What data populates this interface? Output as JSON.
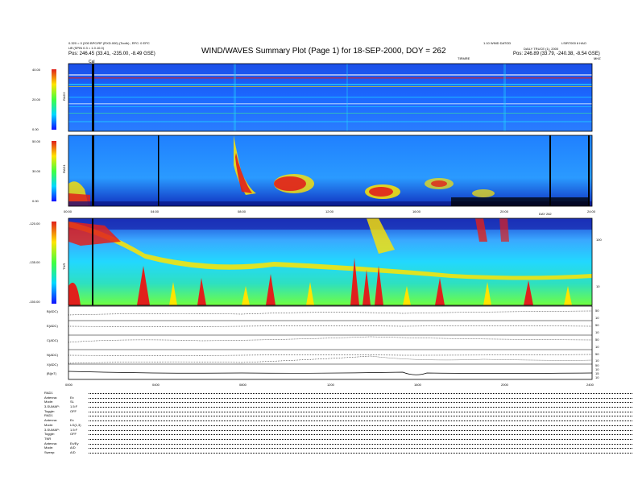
{
  "header": {
    "left_line1": "0.320 = 0 (200 BPC/RP (RXD.000) (Tooth) ; RFC: 0 EPC",
    "left_line2": "Lffi (SPIN 0.3 = 1.0.10.0)",
    "left_pos": "Pos:     246.45 (33.41, -235.00, -8.49 GSE)",
    "title": "WIND/WAVES Summary Plot (Page 1) for 18-SEP-2000, DOY = 262",
    "right_line1": "1.10 WIND DATOD",
    "right_line2": "LSIR7000 6 HAO",
    "right_line3": "DAILY TRUCE (1), 2000",
    "right_pos": "Pos:     246.89 (33.79, -240.38, -8.54 GSE)",
    "tr_label": "TIRMRE",
    "mhz_label": "MHZ",
    "cal_label": "Cal",
    "day_label": "DAY 262"
  },
  "panels": {
    "rad2": {
      "label": "RAD2",
      "ticks": [
        "40.00",
        "20.00",
        "0.00"
      ]
    },
    "rad1": {
      "label": "RAD1",
      "ticks": [
        "50.00",
        "30.00",
        "0.00"
      ]
    },
    "tnr": {
      "label": "TNR",
      "ticks": [
        "-120.00",
        "-135.00",
        "-150.00"
      ],
      "right_ticks": [
        "100",
        "10"
      ]
    }
  },
  "time_ticks": [
    "00:00",
    "04:00",
    "08:00",
    "12:00",
    "16:00",
    "20:00",
    "24:00"
  ],
  "bottom_time_ticks": [
    "0000",
    "0400",
    "0800",
    "1200",
    "1600",
    "2000",
    "2400"
  ],
  "line_panels": [
    {
      "label": "B(ADC)",
      "r1": "50",
      "r2": "10"
    },
    {
      "label": "E(ADC)",
      "r1": "50",
      "r2": "10"
    },
    {
      "label": "C(ADC)",
      "r1": "50",
      "r2": "10"
    },
    {
      "label": "N(ADC)",
      "r1": "50",
      "r2": "10"
    },
    {
      "label": "X(ADC)",
      "r1": "50",
      "r2": "10"
    },
    {
      "label": "|B|(nT)",
      "r1": "15",
      "r2": "10"
    }
  ],
  "legend": [
    {
      "k": "RAD1",
      "v": ""
    },
    {
      "k": "Antenna:",
      "v": "Ex"
    },
    {
      "k": "Mode:",
      "v": "SL"
    },
    {
      "k": "3-SUMAP:",
      "v": "1.5:F"
    },
    {
      "k": "Toggle:",
      "v": "OFF"
    },
    {
      "k": "RAD1",
      "v": ""
    },
    {
      "k": "Antenna:",
      "v": "Ex"
    },
    {
      "k": "Mode:",
      "v": "LG(1,3)"
    },
    {
      "k": "3-SUMAP:",
      "v": "1.5:F"
    },
    {
      "k": "Toggle:",
      "v": "OFF"
    },
    {
      "k": "TNR",
      "v": ""
    },
    {
      "k": "Antenna:",
      "v": "Ex/Ey"
    },
    {
      "k": "Mode:",
      "v": "A/D"
    },
    {
      "k": "Sweep:",
      "v": "A/D"
    }
  ],
  "colors": {
    "bg": "#1a5cff",
    "red": "#e0201c",
    "yellow": "#ffe400",
    "cyan": "#22d8ff"
  }
}
